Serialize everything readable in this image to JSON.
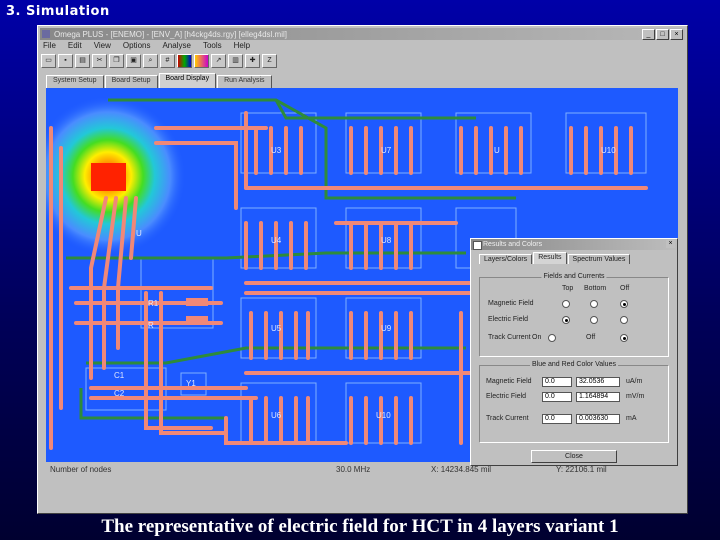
{
  "slide": {
    "title": "3. Simulation",
    "caption": "The representative of electric field for HCT in 4 layers variant 1"
  },
  "window": {
    "title": "Omega PLUS - [ENEMO] - [ENV_A] [h4ckg4ds.rgy] [elleg4dsl.mil]",
    "menu": [
      "File",
      "Edit",
      "View",
      "Options",
      "Analyse",
      "Tools",
      "Help"
    ],
    "toolbar_icons": [
      "open-icon",
      "save-icon",
      "print-icon",
      "cut-icon",
      "copy-icon",
      "paste-icon",
      "zoom-icon",
      "grid-icon",
      "layers-icon",
      "colors-icon",
      "graph-icon",
      "chart-icon",
      "run-icon",
      "stop-icon"
    ],
    "tabs": [
      "System Setup",
      "Board Setup",
      "Board Display",
      "Run Analysis"
    ],
    "active_tab": "Board Display",
    "status": {
      "left": "Number of nodes",
      "freq": "30.0 MHz",
      "x": "X: 14234.845 mil",
      "y": "Y: 22106.1 mil"
    }
  },
  "board": {
    "components": [
      "U3",
      "U7",
      "U",
      "U10",
      "U4",
      "U8",
      "U5",
      "U9",
      "U6",
      "U10",
      "R1",
      "R",
      "C1",
      "C2",
      "Y1",
      "U"
    ],
    "colors": {
      "background": "#1e5aff",
      "trace": "#f08878",
      "green_trace": "#2e8b3a",
      "outline": "#7fb0ff"
    }
  },
  "dialog": {
    "title": "Results and Colors",
    "tabs": [
      "Layers/Colors",
      "Results",
      "Spectrum Values"
    ],
    "active_tab": "Results",
    "fields_group": "Fields and Currents",
    "col_headers": [
      "Top",
      "Bottom",
      "Off"
    ],
    "rows": [
      {
        "label": "Magnetic Field",
        "selected": "Off"
      },
      {
        "label": "Electric Field",
        "selected": "Top"
      },
      {
        "label": "Track Current",
        "selected": "Off"
      }
    ],
    "track_toggle": [
      "On",
      "Off"
    ],
    "values_group": "Blue and Red Color Values",
    "value_rows": [
      {
        "label": "Magnetic Field",
        "min": "0.0",
        "max": "32.0536",
        "unit": "uA/m"
      },
      {
        "label": "Electric Field",
        "min": "0.0",
        "max": "1.164894",
        "unit": "mV/m"
      },
      {
        "label": "Track Current",
        "min": "0.0",
        "max": "0.003630",
        "unit": "mA"
      }
    ],
    "close_label": "Close"
  }
}
